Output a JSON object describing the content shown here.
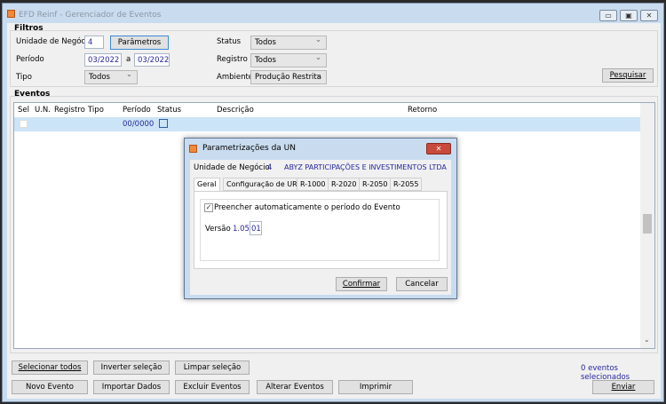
{
  "window": {
    "title": "EFD Reinf - Gerenciador de Eventos",
    "buttons": [
      "▭",
      "▣",
      "✕"
    ]
  },
  "filtros": {
    "group": "Filtros",
    "un_label": "Unidade de Negócio",
    "un_value": "4",
    "parametros": "Parâmetros",
    "periodo_label": "Período",
    "periodo_de": "03/2022",
    "a": "a",
    "periodo_ate": "03/2022",
    "tipo_label": "Tipo",
    "tipo": "Todos",
    "status_label": "Status",
    "status": "Todos",
    "registro_label": "Registro",
    "registro": "Todos",
    "ambiente_label": "Ambiente",
    "ambiente": "Produção Restrita",
    "pesquisar": "Pesquisar"
  },
  "eventos": {
    "group": "Eventos",
    "columns": [
      "Sel",
      "U.N.",
      "Registro",
      "Tipo",
      "Período",
      "Status",
      "Descrição",
      "Retorno"
    ],
    "rows": [
      {
        "periodo": "00/0000"
      }
    ]
  },
  "footer": {
    "selecionar_todos": "Selecionar todos",
    "inverter": "Inverter seleção",
    "limpar": "Limpar seleção",
    "count": "0 eventos selecionados",
    "novo": "Novo Evento",
    "importar": "Importar Dados",
    "excluir": "Excluir Eventos",
    "alterar": "Alterar Eventos",
    "imprimir": "Imprimir",
    "enviar": "Enviar"
  },
  "dialog": {
    "title": "Parametrizações da UN",
    "un_label": "Unidade de Negócio",
    "un_value": "4",
    "empresa": "ABYZ PARTICIPAÇÕES E INVESTIMENTOS LTDA",
    "tabs": [
      "Geral",
      "Configuração de URL",
      "R-1000",
      "R-2020",
      "R-2050",
      "R-2055"
    ],
    "checkbox_label": "Preencher automaticamente o período do Evento",
    "checkbox_checked": true,
    "versao_label": "Versão",
    "versao_value": "1.05",
    "versao_input": "01",
    "confirmar": "Confirmar",
    "cancelar": "Cancelar"
  }
}
